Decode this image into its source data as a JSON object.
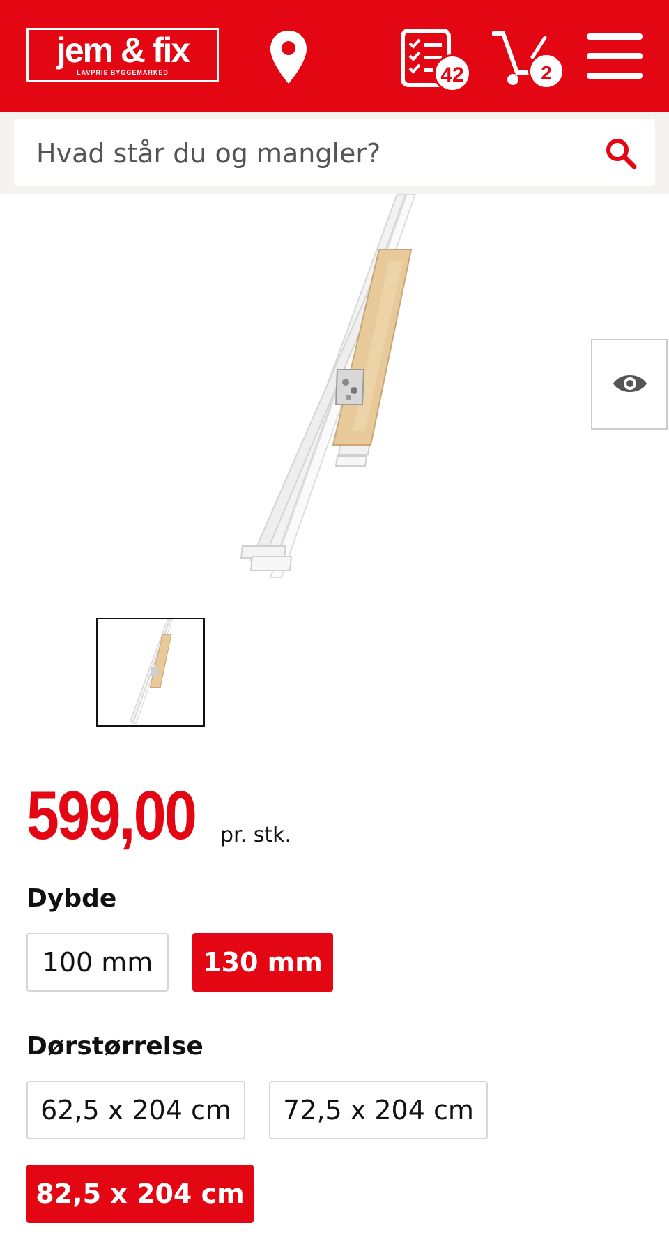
{
  "header": {
    "logo_main": "jem & fix",
    "logo_sub": "LAVPRIS BYGGEMARKED",
    "list_count": "42",
    "cart_count": "2"
  },
  "search": {
    "placeholder": "Hvad står du og mangler?"
  },
  "product": {
    "price": "599,00",
    "unit": "pr. stk."
  },
  "options": {
    "depth": {
      "title": "Dybde",
      "items": [
        {
          "label": "100 mm",
          "selected": false
        },
        {
          "label": "130 mm",
          "selected": true
        }
      ]
    },
    "door_size": {
      "title": "Dørstørrelse",
      "items": [
        {
          "label": "62,5 x 204 cm",
          "selected": false
        },
        {
          "label": "72,5 x 204 cm",
          "selected": false
        },
        {
          "label": "82,5 x 204 cm",
          "selected": true
        }
      ]
    }
  },
  "colors": {
    "brand_red": "#e30613",
    "border_grey": "#d6d6d6"
  },
  "icons": [
    "location-pin-icon",
    "shopping-list-icon",
    "cart-icon",
    "menu-icon",
    "search-icon",
    "eye-icon"
  ]
}
